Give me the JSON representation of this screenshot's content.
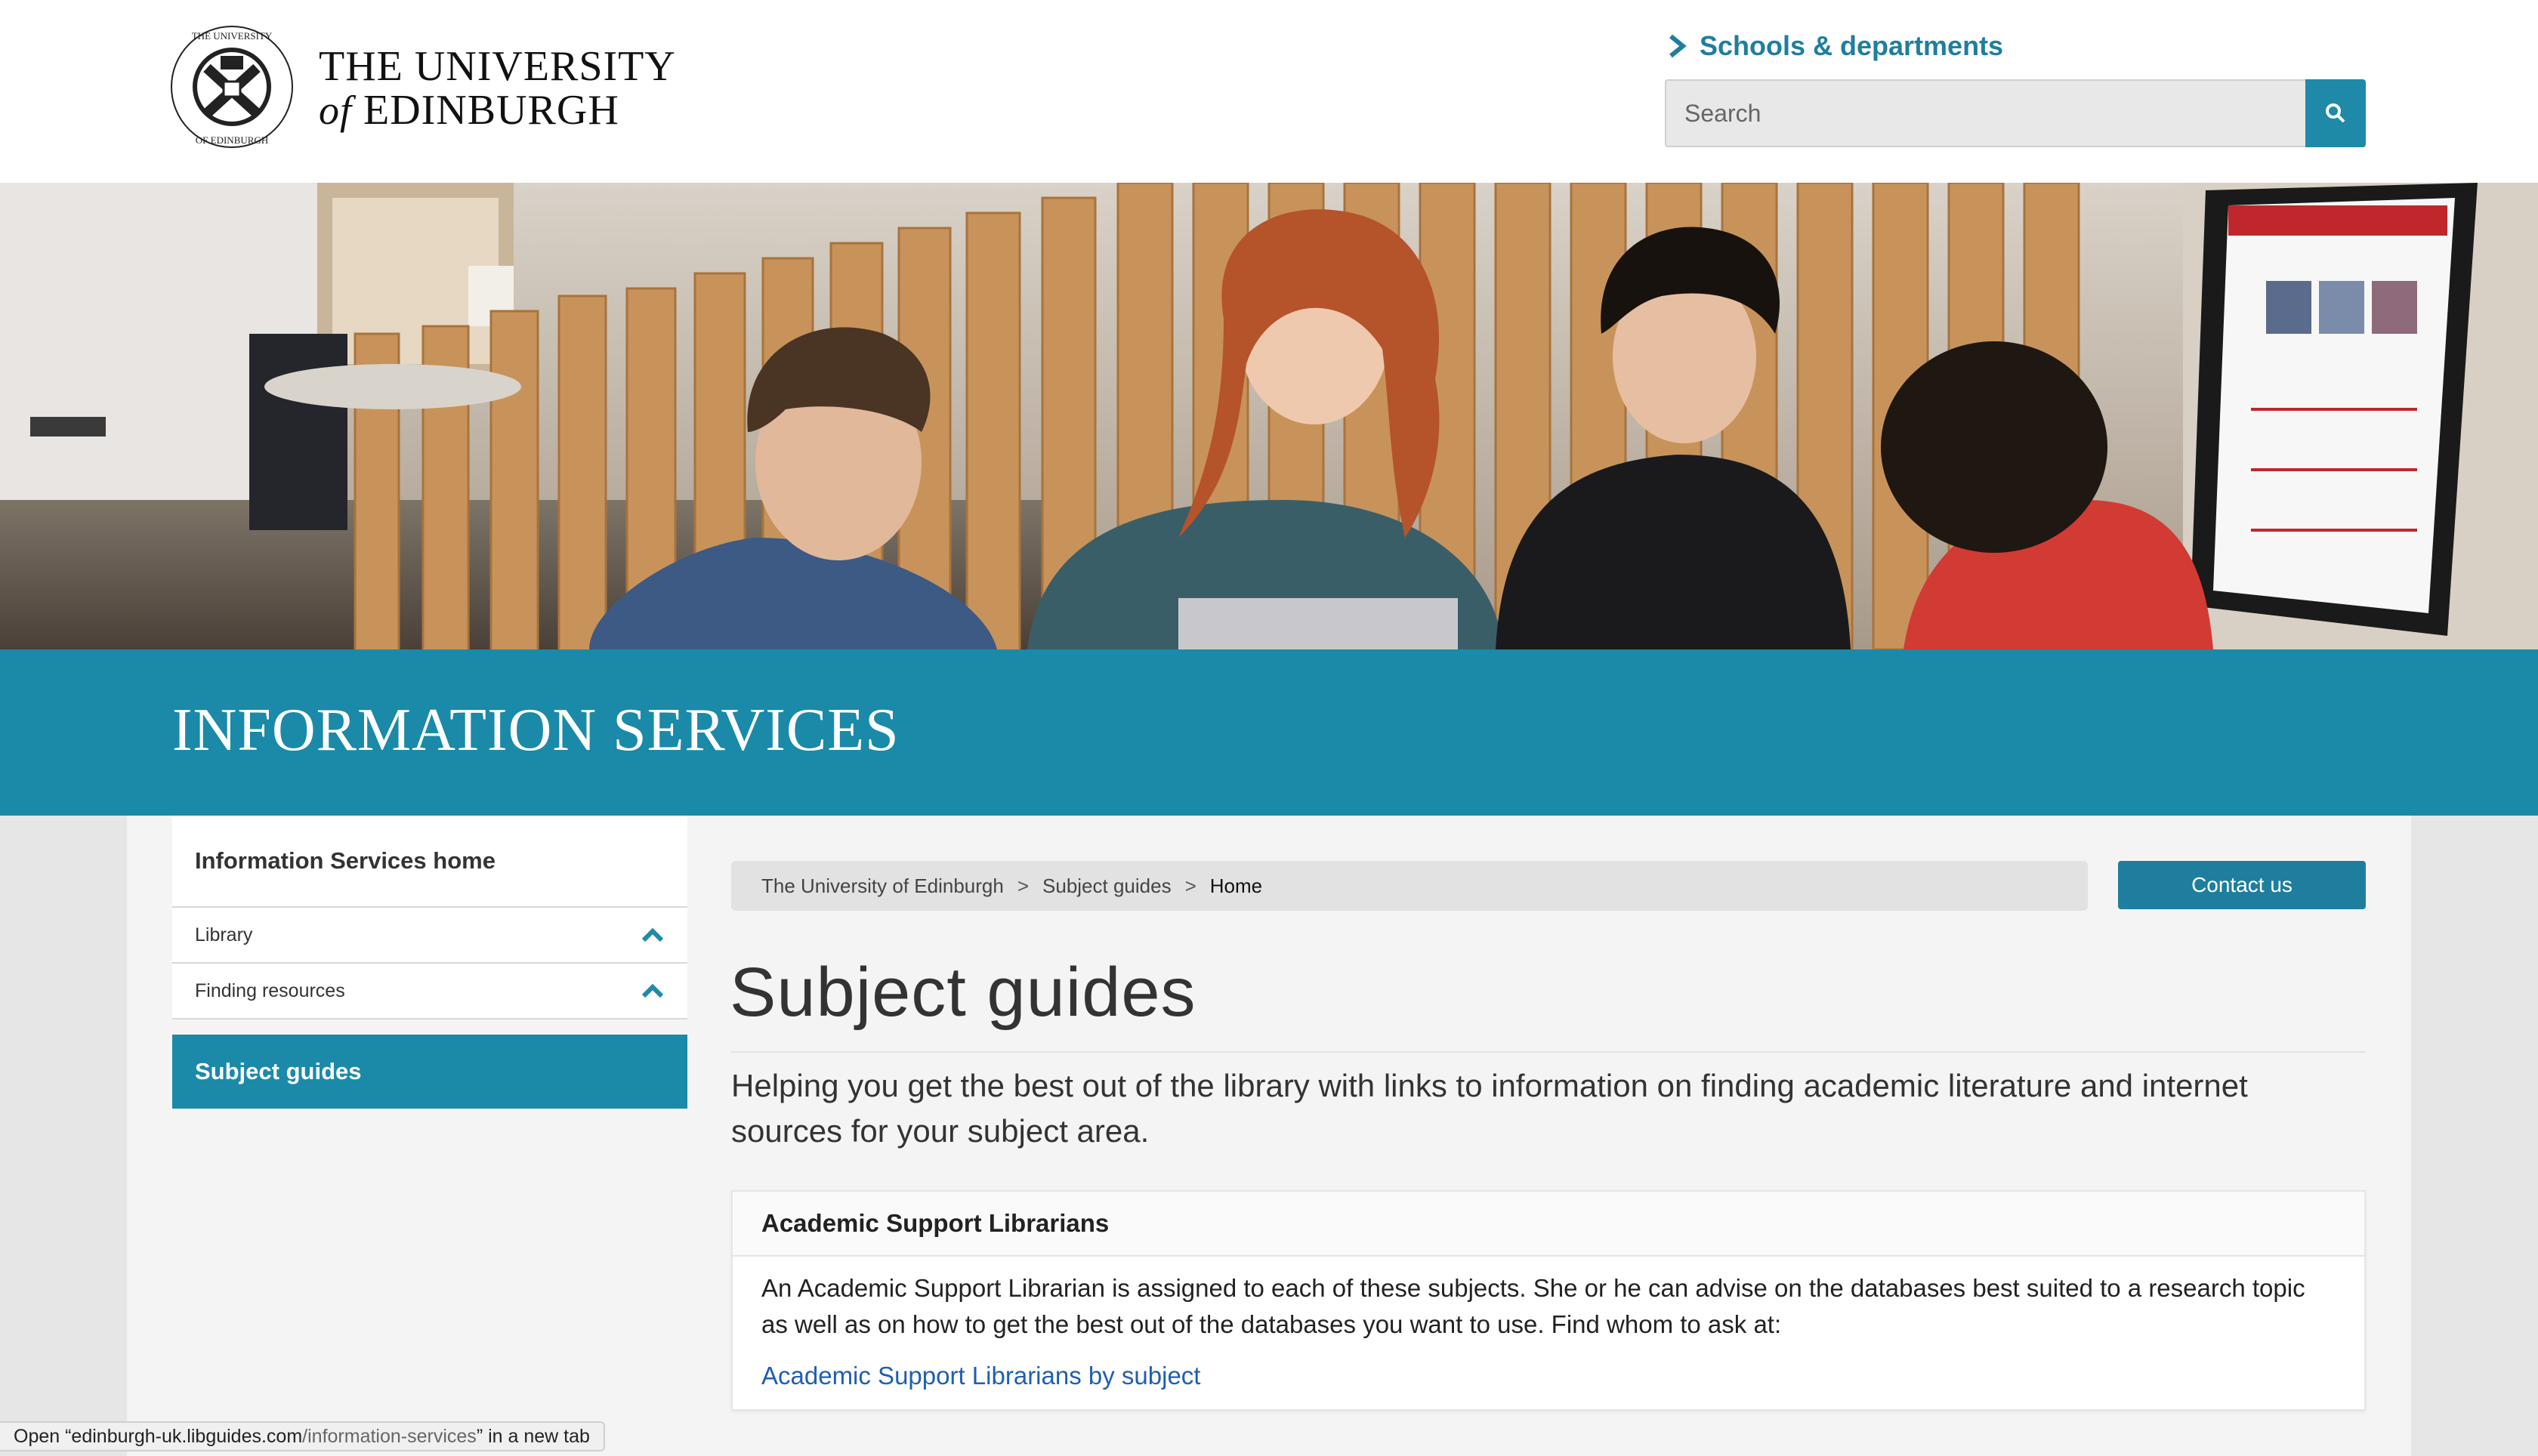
{
  "header": {
    "logo_line1": "THE UNIVERSITY",
    "logo_of": "of",
    "logo_line2": "EDINBURGH",
    "schools_link": "Schools & departments",
    "search_placeholder": "Search"
  },
  "banner": {
    "title": "INFORMATION SERVICES"
  },
  "sidebar": {
    "home": "Information Services home",
    "items": [
      {
        "label": "Library"
      },
      {
        "label": "Finding resources"
      }
    ],
    "active": "Subject guides"
  },
  "breadcrumb": {
    "items": [
      "The University of Edinburgh",
      "Subject guides"
    ],
    "current": "Home",
    "separator": ">"
  },
  "contact_button": "Contact us",
  "main": {
    "title": "Subject guides",
    "intro": "Helping you get the best out of the library with links to information on finding academic literature and internet sources for your subject area.",
    "card": {
      "heading": "Academic Support Librarians",
      "body": "An Academic Support Librarian is assigned to each of these subjects. She or he can advise on the databases best suited to a research topic as well as on how to get the best out of the databases you want to use. Find whom to ask at:",
      "link": "Academic Support Librarians by subject"
    }
  },
  "status_bar": {
    "prefix": "Open “edinburgh-uk.libguides.com",
    "path": "/information-services",
    "suffix": "” in a new tab"
  },
  "colors": {
    "brand_teal": "#1a8aa8",
    "link_blue": "#1f5fb0"
  }
}
